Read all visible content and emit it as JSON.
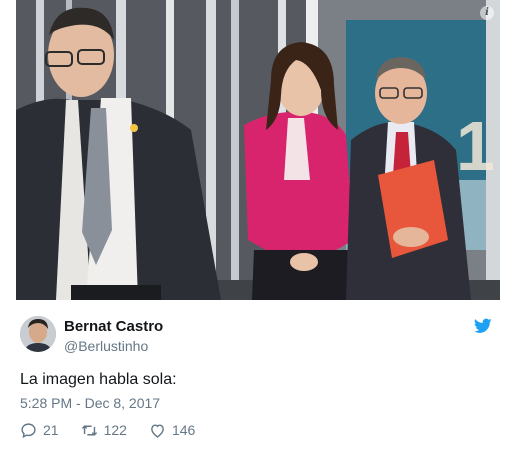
{
  "photo": {
    "alt_icon": "info-icon",
    "info_glyph": "i"
  },
  "tweet": {
    "display_name": "Bernat Castro",
    "handle": "@Berlustinho",
    "text": "La imagen habla sola:",
    "timestamp": "5:28 PM - Dec 8, 2017",
    "bird_icon": "twitter-bird-icon",
    "actions": {
      "replies": "21",
      "retweets": "122",
      "likes": "146"
    }
  },
  "colors": {
    "brand_blue": "#1da1f2",
    "secondary_text": "#657786",
    "primary_text": "#14171a"
  }
}
